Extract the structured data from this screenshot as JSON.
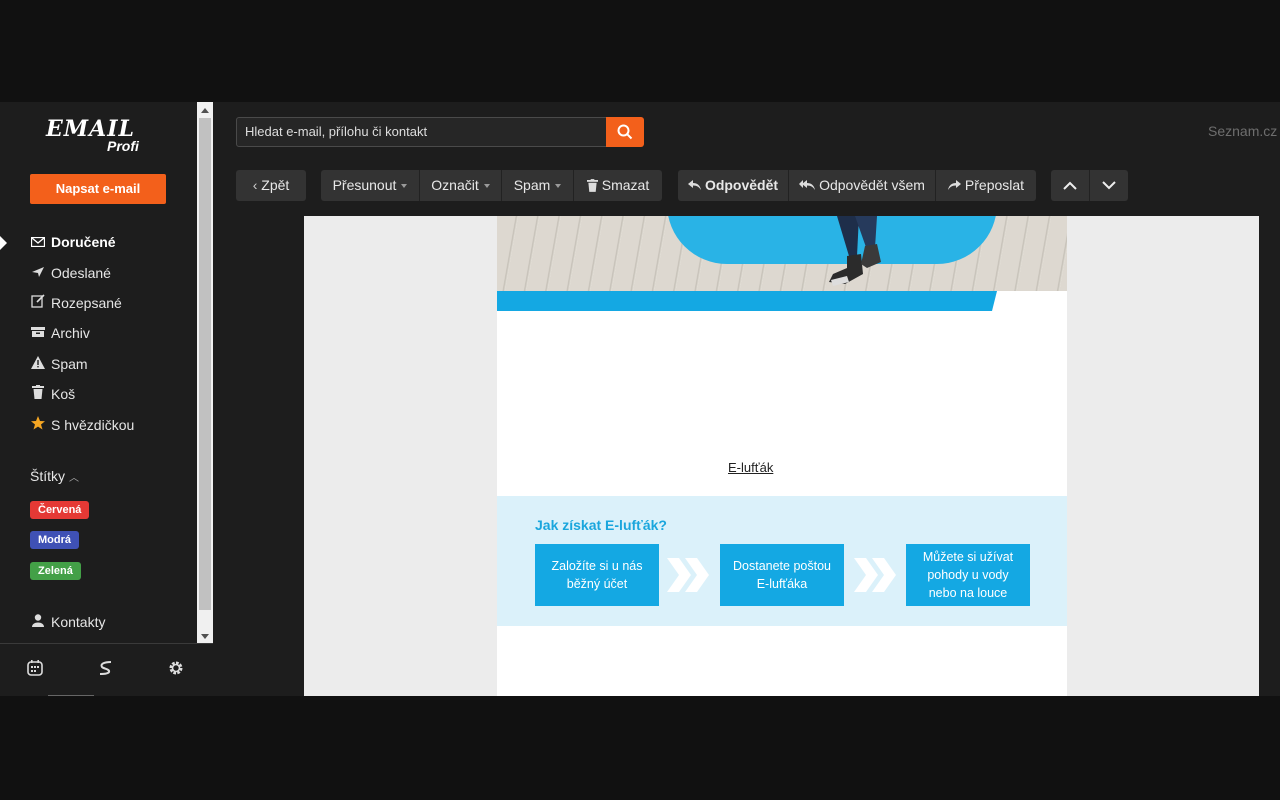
{
  "sidebar": {
    "logo_text": "EMAIL",
    "logo_sub": "Profi",
    "compose_label": "Napsat e-mail",
    "items": [
      {
        "label": "Doručené",
        "icon": "inbox-icon"
      },
      {
        "label": "Odeslané",
        "icon": "send-icon"
      },
      {
        "label": "Rozepsané",
        "icon": "draft-icon"
      },
      {
        "label": "Archiv",
        "icon": "archive-icon"
      },
      {
        "label": "Spam",
        "icon": "warning-icon"
      },
      {
        "label": "Koš",
        "icon": "trash-icon"
      },
      {
        "label": "S hvězdičkou",
        "icon": "star-icon"
      }
    ],
    "labels_title": "Štítky",
    "labels": [
      {
        "label": "Červená",
        "color": "#e53935"
      },
      {
        "label": "Modrá",
        "color": "#3f51b5"
      },
      {
        "label": "Zelená",
        "color": "#43a047"
      }
    ],
    "contacts_label": "Kontakty",
    "bottom_icons": [
      "calendar-icon",
      "seznam-s-icon",
      "settings-icon"
    ]
  },
  "search": {
    "placeholder": "Hledat e-mail, přílohu či kontakt"
  },
  "brand_link": "Seznam.cz",
  "toolbar": {
    "back": "Zpět",
    "move": "Přesunout",
    "mark": "Označit",
    "spam": "Spam",
    "delete": "Smazat",
    "reply": "Odpovědět",
    "reply_all": "Odpovědět všem",
    "forward": "Přeposlat"
  },
  "email": {
    "link_text": "E-lufťák",
    "how_title": "Jak získat E-lufťák?",
    "steps": [
      {
        "line1": "Založíte si u nás",
        "line2": "běžný účet"
      },
      {
        "line1": "Dostanete poštou",
        "line2": "E-lufťáka"
      },
      {
        "line1": "Můžete si užívat",
        "line2": "pohody u vody",
        "line3": "nebo na louce"
      }
    ]
  },
  "colors": {
    "accent": "#f3601b",
    "brand_blue": "#14a8e3"
  }
}
